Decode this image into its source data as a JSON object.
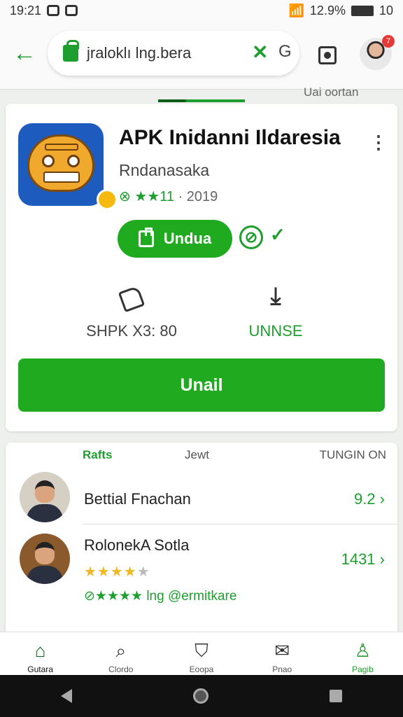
{
  "status_bar": {
    "time": "19:21",
    "battery_text": "12.9%",
    "battery_num": "10"
  },
  "toolbar": {
    "url": "jraloklı lng.bera",
    "g_label": "G",
    "notification_count": "7"
  },
  "corner_text": "Uai oortan",
  "app": {
    "title": "APK Inidanni Ildaresia",
    "developer": "Rndanasaka",
    "rating_text": "★★11",
    "rating_extra": "· 2019",
    "install_label": "Undua",
    "stats": [
      {
        "value": "SHPK X3: 80",
        "icon": "tag-icon"
      },
      {
        "value": "UNNSE",
        "icon": "download-icon"
      }
    ],
    "primary_button": "Unail"
  },
  "list": {
    "headers": [
      "Rafts",
      "Jewt",
      "TUNGIN ON"
    ],
    "rows": [
      {
        "name": "Bettial Fnachan",
        "score": "9.2"
      },
      {
        "name": "RolonekA Sotla",
        "score": "1431",
        "stars_on": 4,
        "stars_total": 5,
        "subline": "★★★★ lng @ermitkare"
      }
    ]
  },
  "bottom_nav": [
    {
      "label": "Gutara",
      "icon": "home-icon"
    },
    {
      "label": "Clordo",
      "icon": "search-icon"
    },
    {
      "label": "Eoopa",
      "icon": "bookmark-icon"
    },
    {
      "label": "Pnao",
      "icon": "mail-icon"
    },
    {
      "label": "Pagib",
      "icon": "person-icon",
      "active": true
    }
  ],
  "colors": {
    "accent": "#1faa1f",
    "accent_dark": "#0e5e1a",
    "star": "#f2b824"
  }
}
